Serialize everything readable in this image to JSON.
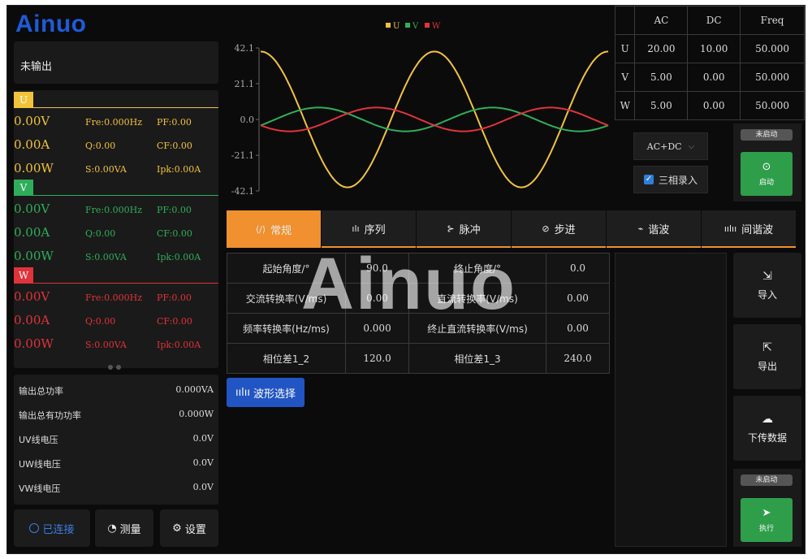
{
  "app": {
    "logo": "Ainuo",
    "watermark": "Ainuo",
    "output_status": "未输出"
  },
  "phases": [
    {
      "tag": "U",
      "color": "#f2c23c",
      "voltage": "0.00V",
      "current": "0.00A",
      "power": "0.00W",
      "fre": "Fre:0.000Hz",
      "q": "Q:0.00",
      "s": "S:0.00VA",
      "pf": "PF:0.00",
      "cf": "CF:0.00",
      "ipk": "Ipk:0.00A"
    },
    {
      "tag": "V",
      "color": "#2fae5a",
      "voltage": "0.00V",
      "current": "0.00A",
      "power": "0.00W",
      "fre": "Fre:0.000Hz",
      "q": "Q:0.00",
      "s": "S:0.00VA",
      "pf": "PF:0.00",
      "cf": "CF:0.00",
      "ipk": "Ipk:0.00A"
    },
    {
      "tag": "W",
      "color": "#e0333a",
      "voltage": "0.00V",
      "current": "0.00A",
      "power": "0.00W",
      "fre": "Fre:0.000Hz",
      "q": "Q:0.00",
      "s": "S:0.00VA",
      "pf": "PF:0.00",
      "cf": "CF:0.00",
      "ipk": "Ipk:0.00A"
    }
  ],
  "power_summary": [
    {
      "label": "输出总功率",
      "value": "0.000VA"
    },
    {
      "label": "输出总有功功率",
      "value": "0.000W"
    },
    {
      "label": "UV线电压",
      "value": "0.0V"
    },
    {
      "label": "UW线电压",
      "value": "0.0V"
    },
    {
      "label": "VW线电压",
      "value": "0.0V"
    }
  ],
  "bottom_nav": {
    "connected": "已连接",
    "measure": "测量",
    "settings": "设置"
  },
  "chart_data": {
    "type": "line",
    "legend": [
      "U",
      "V",
      "W"
    ],
    "legend_position": "top-center",
    "colors": [
      "#f2c23c",
      "#2fae5a",
      "#e0333a"
    ],
    "y_ticks": [
      "42.1",
      "21.1",
      "0.0",
      "-21.1",
      "-42.1"
    ],
    "ylim": [
      -42.1,
      42.1
    ],
    "series": [
      {
        "name": "U",
        "amplitude": 40,
        "cycles": 2,
        "phase_deg": 90
      },
      {
        "name": "V",
        "amplitude": 7,
        "cycles": 2,
        "phase_deg": -30
      },
      {
        "name": "W",
        "amplitude": 7,
        "cycles": 2,
        "phase_deg": 210
      }
    ],
    "grid": false
  },
  "settings_table": {
    "headers": [
      "AC",
      "DC",
      "Freq"
    ],
    "rows": [
      {
        "phase": "U",
        "ac": "20.00",
        "dc": "10.00",
        "freq": "50.000"
      },
      {
        "phase": "V",
        "ac": "5.00",
        "dc": "0.00",
        "freq": "50.000"
      },
      {
        "phase": "W",
        "ac": "5.00",
        "dc": "0.00",
        "freq": "50.000"
      }
    ]
  },
  "mode_select": "AC+DC",
  "three_phase_entry": "三相录入",
  "start_panel": {
    "badge": "未启动",
    "button": "启动"
  },
  "exec_panel": {
    "badge": "未启动",
    "button": "执行"
  },
  "tabs": [
    "常规",
    "序列",
    "脉冲",
    "步进",
    "谐波",
    "间谐波"
  ],
  "params": [
    {
      "l1": "起始角度/°",
      "v1": "90.0",
      "l2": "终止角度/°",
      "v2": "0.0"
    },
    {
      "l1": "交流转换率(V/ms)",
      "v1": "0.00",
      "l2": "直流转换率(V/ms)",
      "v2": "0.00"
    },
    {
      "l1": "频率转换率(Hz/ms)",
      "v1": "0.000",
      "l2": "终止直流转换率(V/ms)",
      "v2": "0.00"
    },
    {
      "l1": "相位差1_2",
      "v1": "120.0",
      "l2": "相位差1_3",
      "v2": "240.0"
    }
  ],
  "wave_select": "波形选择",
  "side_buttons": {
    "import": "导入",
    "export": "导出",
    "download": "下传数据"
  }
}
